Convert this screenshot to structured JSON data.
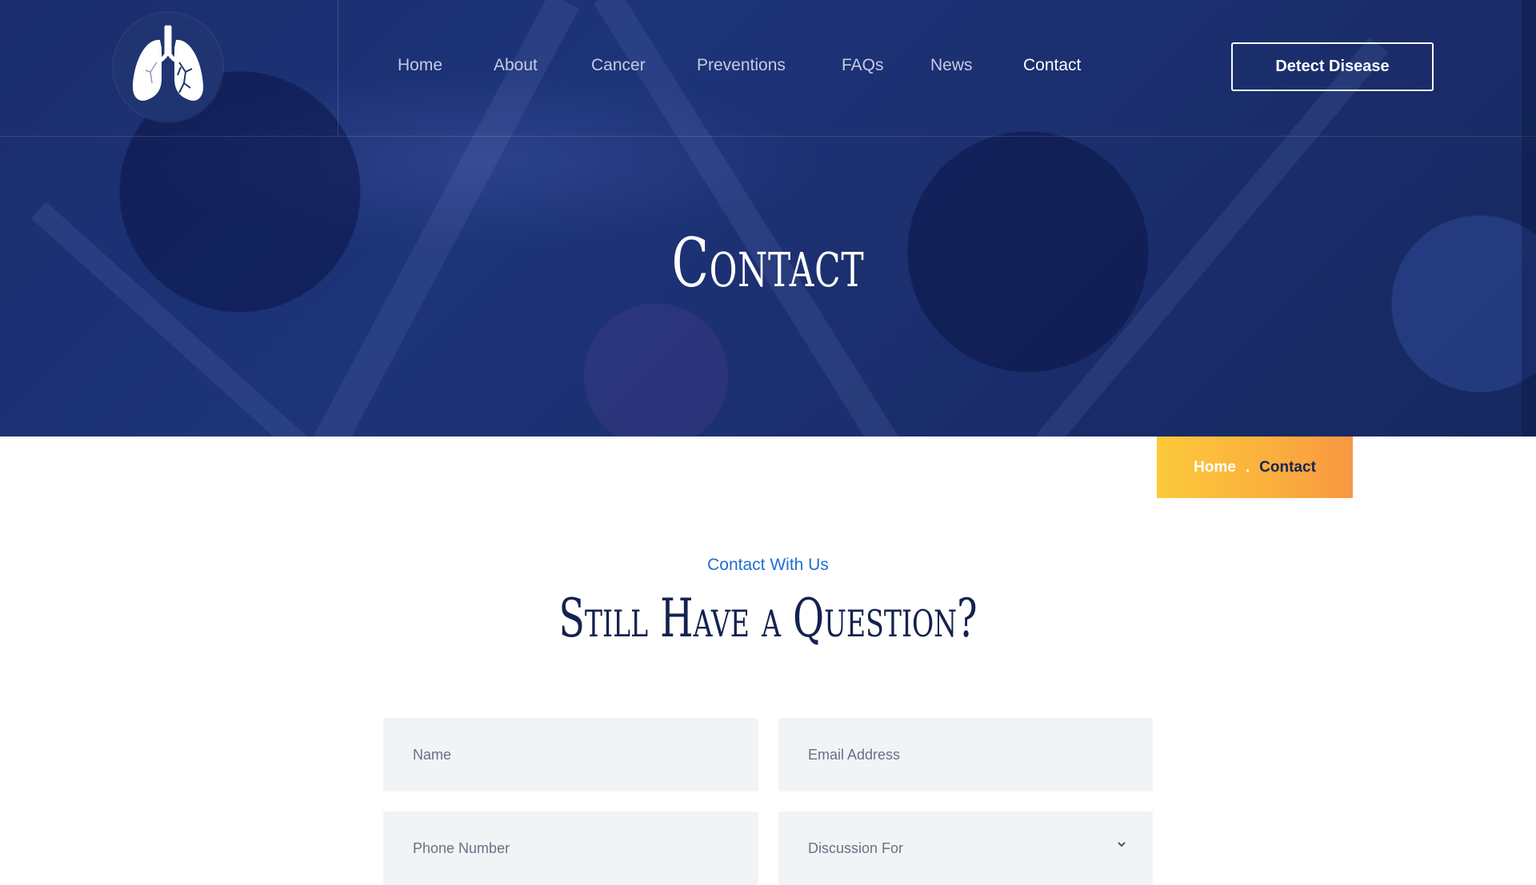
{
  "header": {
    "logo_icon": "lungs-icon",
    "nav": [
      {
        "label": "Home",
        "active": false
      },
      {
        "label": "About",
        "active": false
      },
      {
        "label": "Cancer",
        "active": false
      },
      {
        "label": "Preventions",
        "active": false
      },
      {
        "label": "FAQs",
        "active": false
      },
      {
        "label": "News",
        "active": false
      },
      {
        "label": "Contact",
        "active": true
      }
    ],
    "cta_label": "Detect Disease"
  },
  "hero": {
    "title": "Contact"
  },
  "breadcrumb": {
    "home": "Home",
    "separator": ".",
    "current": "Contact"
  },
  "contact_section": {
    "kicker": "Contact With Us",
    "title": "Still Have a Question?",
    "fields": {
      "name_placeholder": "Name",
      "email_placeholder": "Email Address",
      "phone_placeholder": "Phone Number",
      "discussion_placeholder": "Discussion For"
    }
  },
  "colors": {
    "hero_bg": "#1d3479",
    "accent_blue": "#1f6fd1",
    "heading_navy": "#13224f",
    "breadcrumb_gradient_start": "#fcc93a",
    "breadcrumb_gradient_end": "#f99642",
    "field_bg": "#f2f3f6"
  }
}
